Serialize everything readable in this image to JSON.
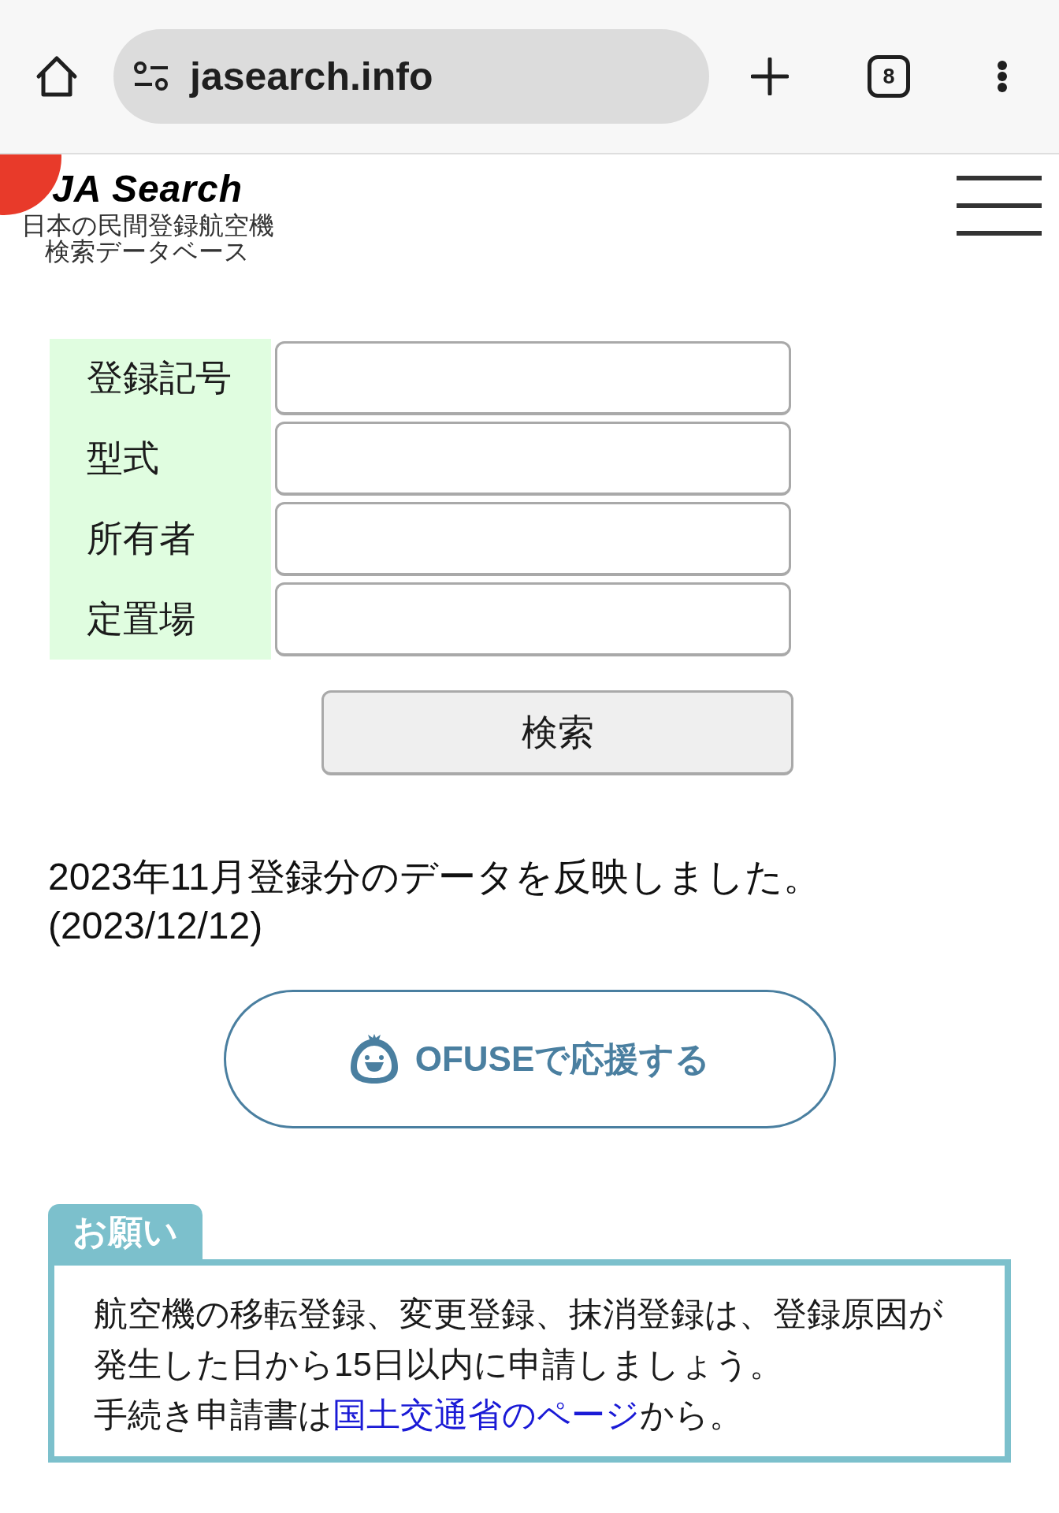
{
  "browser": {
    "url": "jasearch.info",
    "tab_count": "8"
  },
  "header": {
    "logo": {
      "title": "JA Search",
      "subtitle": [
        "日本の民間登録航空機",
        "検索データベース"
      ]
    }
  },
  "search_form": {
    "fields": [
      {
        "label": "登録記号"
      },
      {
        "label": "型式"
      },
      {
        "label": "所有者"
      },
      {
        "label": "定置場"
      }
    ],
    "submit": "検索"
  },
  "update_notice": {
    "lines": [
      "2023年11月登録分のデータを反映しました。",
      "(2023/12/12)"
    ]
  },
  "support_button": {
    "label": "OFUSEで応援する"
  },
  "request_box": {
    "tab": "お願い",
    "lines": [
      "航空機の移転登録、変更登録、抹消登録は、登録原因が",
      "発生した日から15日以内に申請しましょう。"
    ],
    "link_line": {
      "before": "手続き申請書は",
      "link": "国土交通省のページ",
      "after": "から。"
    }
  }
}
